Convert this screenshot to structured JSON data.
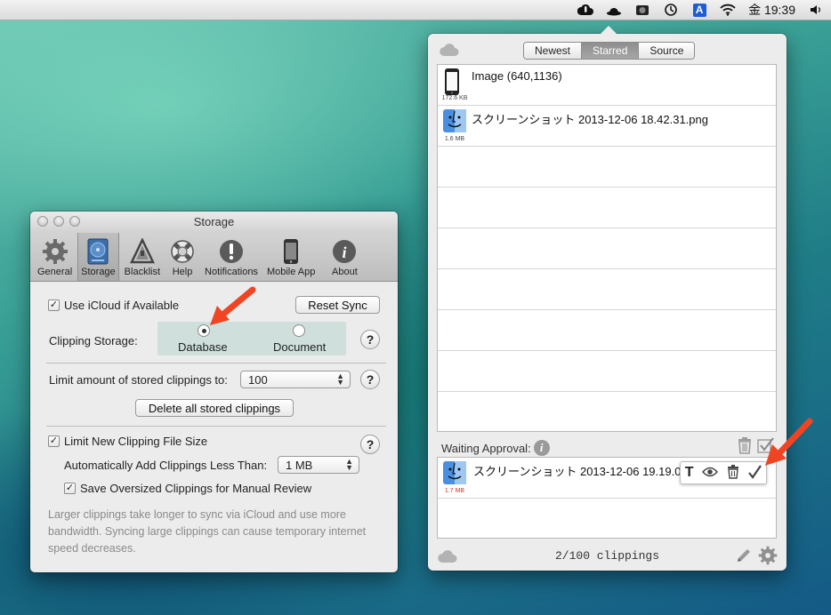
{
  "menubar": {
    "clock": "金 19:39"
  },
  "storage_window": {
    "title": "Storage",
    "tabs": [
      {
        "label": "General",
        "icon": "gear-icon"
      },
      {
        "label": "Storage",
        "icon": "hard-drive-icon"
      },
      {
        "label": "Blacklist",
        "icon": "blacklist-icon"
      },
      {
        "label": "Help",
        "icon": "lifebuoy-icon"
      },
      {
        "label": "Notifications",
        "icon": "exclamation-icon"
      },
      {
        "label": "Mobile App",
        "icon": "iphone-icon"
      },
      {
        "label": "About",
        "icon": "info-icon"
      }
    ],
    "selected_tab": "Storage",
    "use_icloud_label": "Use iCloud if Available",
    "use_icloud_checked": true,
    "reset_sync_label": "Reset Sync",
    "clipping_storage_label": "Clipping Storage:",
    "storage_option_database": "Database",
    "storage_option_document": "Document",
    "storage_selected": "Database",
    "limit_label": "Limit amount of stored clippings to:",
    "limit_value": "100",
    "delete_all_label": "Delete all stored clippings",
    "limit_file_size_label": "Limit New Clipping File Size",
    "limit_file_size_checked": true,
    "auto_add_label": "Automatically Add Clippings Less Than:",
    "auto_add_value": "1 MB",
    "save_oversized_label": "Save Oversized Clippings for Manual Review",
    "save_oversized_checked": true,
    "note": "Larger clippings take longer to sync via iCloud and use more bandwidth.  Syncing large clippings can cause temporary internet speed decreases."
  },
  "clippings_panel": {
    "segments": [
      "Newest",
      "Starred",
      "Source"
    ],
    "selected_segment": "Starred",
    "items": [
      {
        "title": "Image (640,1136)",
        "size": "172.6 KB",
        "icon": "iphone-icon"
      },
      {
        "title": "スクリーンショット 2013-12-06 18.42.31.png",
        "size": "1.6 MB",
        "icon": "finder-icon"
      }
    ],
    "waiting_approval_label": "Waiting Approval:",
    "pending_items": [
      {
        "title": "スクリーンショット 2013-12-06 19.19.0",
        "size": "1.7 MB",
        "size_color": "#d0342c"
      }
    ],
    "count_label": "2/100 clippings"
  },
  "colors": {
    "annotation_arrow": "#f04423",
    "selected_segment": "#989898"
  }
}
